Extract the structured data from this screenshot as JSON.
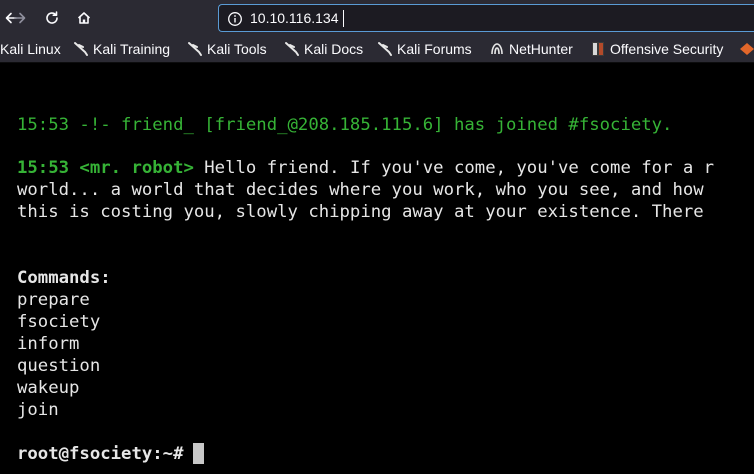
{
  "browser": {
    "url": "10.10.116.134",
    "bookmarks": [
      "Kali Linux",
      "Kali Training",
      "Kali Tools",
      "Kali Docs",
      "Kali Forums",
      "NetHunter",
      "Offensive Security"
    ]
  },
  "terminal": {
    "join_line": "15:53 -!- friend_ [friend_@208.185.115.6] has joined #fsociety.",
    "msg_prefix": "15:53 <mr. robot>",
    "msg_line1": " Hello friend. If you've come, you've come for a r",
    "msg_line2": "world... a world that decides where you work, who you see, and how",
    "msg_line3": "this is costing you, slowly chipping away at your existence. There",
    "commands_header": "Commands:",
    "commands": [
      "prepare",
      "fsociety",
      "inform",
      "question",
      "wakeup",
      "join"
    ],
    "prompt": "root@fsociety:~#"
  },
  "colors": {
    "toolbar_bg": "#2b2a33",
    "terminal_green": "#36b336",
    "terminal_text": "#e6e6e6"
  }
}
